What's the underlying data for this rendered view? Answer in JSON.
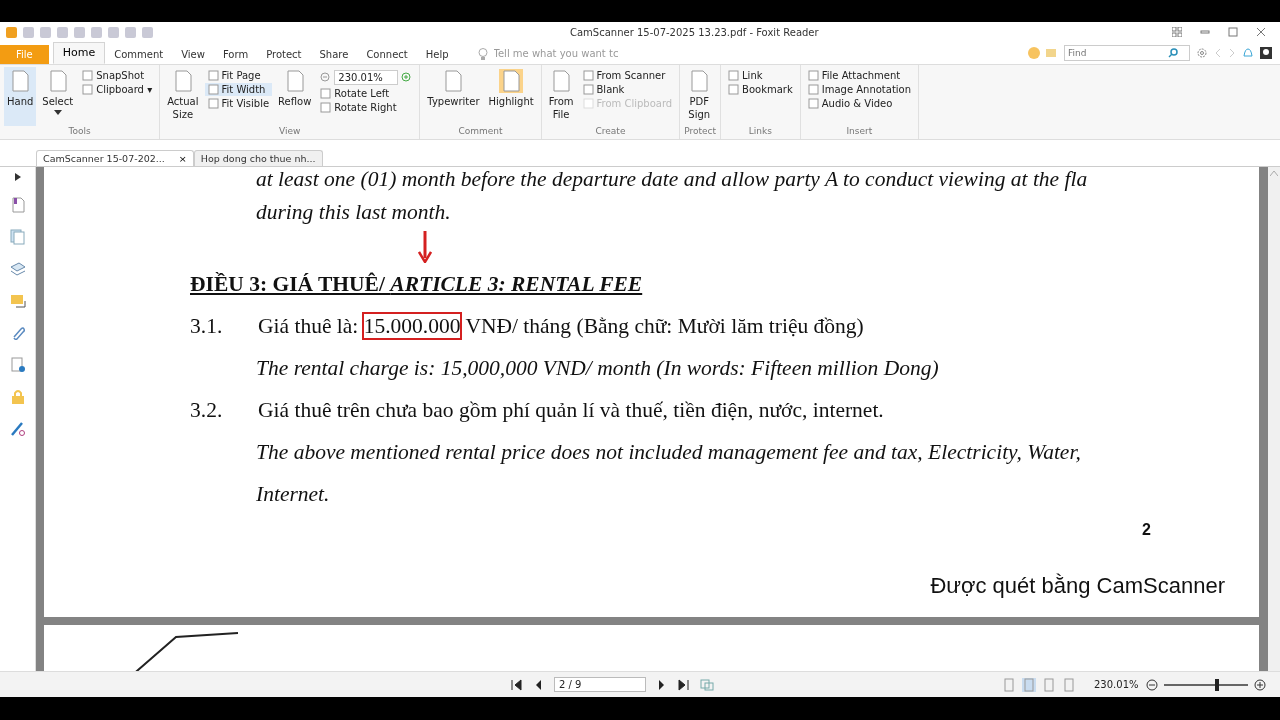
{
  "window": {
    "title": "CamScanner 15-07-2025 13.23.pdf - Foxit Reader"
  },
  "menu_tabs": [
    {
      "label": "File",
      "kind": "file",
      "selected": false
    },
    {
      "label": "Home",
      "kind": "tab",
      "selected": true
    },
    {
      "label": "Comment",
      "kind": "tab",
      "selected": false
    },
    {
      "label": "View",
      "kind": "tab",
      "selected": false
    },
    {
      "label": "Form",
      "kind": "tab",
      "selected": false
    },
    {
      "label": "Protect",
      "kind": "tab",
      "selected": false
    },
    {
      "label": "Share",
      "kind": "tab",
      "selected": false
    },
    {
      "label": "Connect",
      "kind": "tab",
      "selected": false
    },
    {
      "label": "Help",
      "kind": "tab",
      "selected": false
    }
  ],
  "tell_me": {
    "placeholder": "Tell me what you want tc"
  },
  "find": {
    "placeholder": "Find"
  },
  "ribbon_groups": [
    {
      "label": "Tools",
      "columns": [
        {
          "kind": "large",
          "label": "Hand",
          "selected": true
        },
        {
          "kind": "large",
          "label": "Select",
          "selected": false,
          "caret": true
        },
        {
          "kind": "stack",
          "items": [
            {
              "label": "SnapShot",
              "selected": false,
              "disabled": false
            },
            {
              "label": "Clipboard ▾",
              "selected": false,
              "disabled": false
            }
          ]
        }
      ]
    },
    {
      "label": "View",
      "columns": [
        {
          "kind": "large",
          "label": "Actual Size",
          "selected": false
        },
        {
          "kind": "stack",
          "items": [
            {
              "label": "Fit Page",
              "selected": false,
              "disabled": false
            },
            {
              "label": "Fit Width",
              "selected": true,
              "disabled": false
            },
            {
              "label": "Fit Visible",
              "selected": false,
              "disabled": false
            }
          ]
        },
        {
          "kind": "large",
          "label": "Reflow",
          "selected": false
        },
        {
          "kind": "zoom",
          "value": "230.01%",
          "items": [
            {
              "label": "Rotate Left",
              "selected": false,
              "disabled": false
            },
            {
              "label": "Rotate Right",
              "selected": false,
              "disabled": false
            }
          ]
        }
      ]
    },
    {
      "label": "Comment",
      "columns": [
        {
          "kind": "large",
          "label": "Typewriter",
          "selected": false
        },
        {
          "kind": "large",
          "label": "Highlight",
          "selected": true
        }
      ]
    },
    {
      "label": "Create",
      "columns": [
        {
          "kind": "large",
          "label": "From File",
          "selected": false
        },
        {
          "kind": "stack",
          "items": [
            {
              "label": "From Scanner",
              "selected": false,
              "disabled": false
            },
            {
              "label": "Blank",
              "selected": false,
              "disabled": false
            },
            {
              "label": "From Clipboard",
              "selected": false,
              "disabled": true
            }
          ]
        }
      ]
    },
    {
      "label": "Protect",
      "columns": [
        {
          "kind": "large",
          "label": "PDF Sign",
          "selected": false
        }
      ]
    },
    {
      "label": "Links",
      "columns": [
        {
          "kind": "stack",
          "items": [
            {
              "label": "Link",
              "selected": false,
              "disabled": false
            },
            {
              "label": "Bookmark",
              "selected": false,
              "disabled": false
            }
          ]
        }
      ]
    },
    {
      "label": "Insert",
      "columns": [
        {
          "kind": "stack",
          "items": [
            {
              "label": "File Attachment",
              "selected": false,
              "disabled": false
            },
            {
              "label": "Image Annotation",
              "selected": false,
              "disabled": false
            },
            {
              "label": "Audio & Video",
              "selected": false,
              "disabled": false
            }
          ]
        }
      ]
    }
  ],
  "doc_tabs": [
    {
      "label": "CamScanner 15-07-202...",
      "selected": true,
      "close": "×"
    },
    {
      "label": "Hop dong cho thue nh...",
      "selected": false
    }
  ],
  "document": {
    "lines": [
      {
        "kind": "en",
        "text": "at least one (01) month before the departure date and allow party A to conduct viewing at the fla"
      },
      {
        "kind": "en",
        "text": "during this last month."
      },
      {
        "kind": "heading",
        "parts": [
          {
            "text": "ĐIỀU 3: GIÁ THUÊ/ ",
            "italic": false
          },
          {
            "text": "ARTICLE 3: RENTAL FEE",
            "italic": true
          }
        ]
      },
      {
        "kind": "vi",
        "number": "3.1.",
        "parts": [
          {
            "text": "Giá thuê là: ",
            "boxed": false
          },
          {
            "text": "15.000.000",
            "boxed": true
          },
          {
            "text": " VNĐ/ tháng (Bằng chữ: Mười lăm triệu đồng)",
            "boxed": false
          }
        ]
      },
      {
        "kind": "en",
        "text": "The rental charge is: 15,000,000 VND/ month (In words: Fifteen million Dong)"
      },
      {
        "kind": "vi",
        "number": "3.2.",
        "parts": [
          {
            "text": "Giá thuê trên chưa bao gồm phí quản lí và thuế, tiền điện, nước, internet.",
            "boxed": false
          }
        ]
      },
      {
        "kind": "en",
        "text": "The above mentioned rental price does not included management fee and tax, Electricity, Water,"
      },
      {
        "kind": "en",
        "text": "Internet."
      }
    ],
    "page_number": "2",
    "footer": "Được quét bằng CamScanner"
  },
  "status_bar": {
    "page": "2 / 9",
    "zoom": "230.01%",
    "level": 0.63,
    "layouts": [
      {
        "selected": false
      },
      {
        "selected": true
      },
      {
        "selected": false
      },
      {
        "selected": false
      }
    ]
  }
}
